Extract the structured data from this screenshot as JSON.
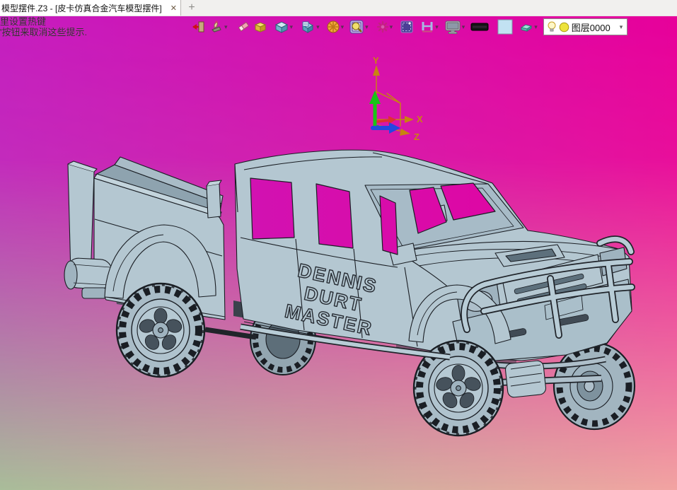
{
  "tab_bar": {
    "active_tab_title": "模型摆件.Z3 - [皮卡仿真合金汽车模型摆件]",
    "close_label": "✕",
    "new_tab_label": "+"
  },
  "hint_overlay": {
    "line1": "里设置热键",
    "line2": "'按钮来取消这些提示."
  },
  "toolbar": {
    "caret": "▾",
    "layer_selector": {
      "value": "图层0000"
    },
    "icon_names": [
      "exit",
      "hotkey-hand",
      "eraser",
      "yellow-box",
      "cube",
      "box-plane",
      "wheel",
      "zoom-box",
      "pattern-flower",
      "select-region",
      "h-beam",
      "display",
      "line-width",
      "color-swatch",
      "eraser-3d",
      "layer-bulb",
      "layer-color"
    ]
  },
  "triad": {
    "label_x": "X",
    "label_y": "Y",
    "label_z": "Z"
  },
  "model_decal": {
    "line1": "DENNIS",
    "line2": "DURT",
    "line3": "MASTER"
  },
  "colors": {
    "bg_top_left": "#c51cbf",
    "bg_top_right": "#e7009a",
    "bg_bottom_left": "#a9bd9a",
    "bg_bottom_right": "#f2a4a2",
    "body": "#b4c7d1",
    "body_shade": "#9fb3bf",
    "outline": "#1a1e24",
    "axis_orange": "#c88410",
    "axis_green": "#17c517",
    "axis_blue": "#2547e0",
    "axis_red": "#e03131"
  }
}
